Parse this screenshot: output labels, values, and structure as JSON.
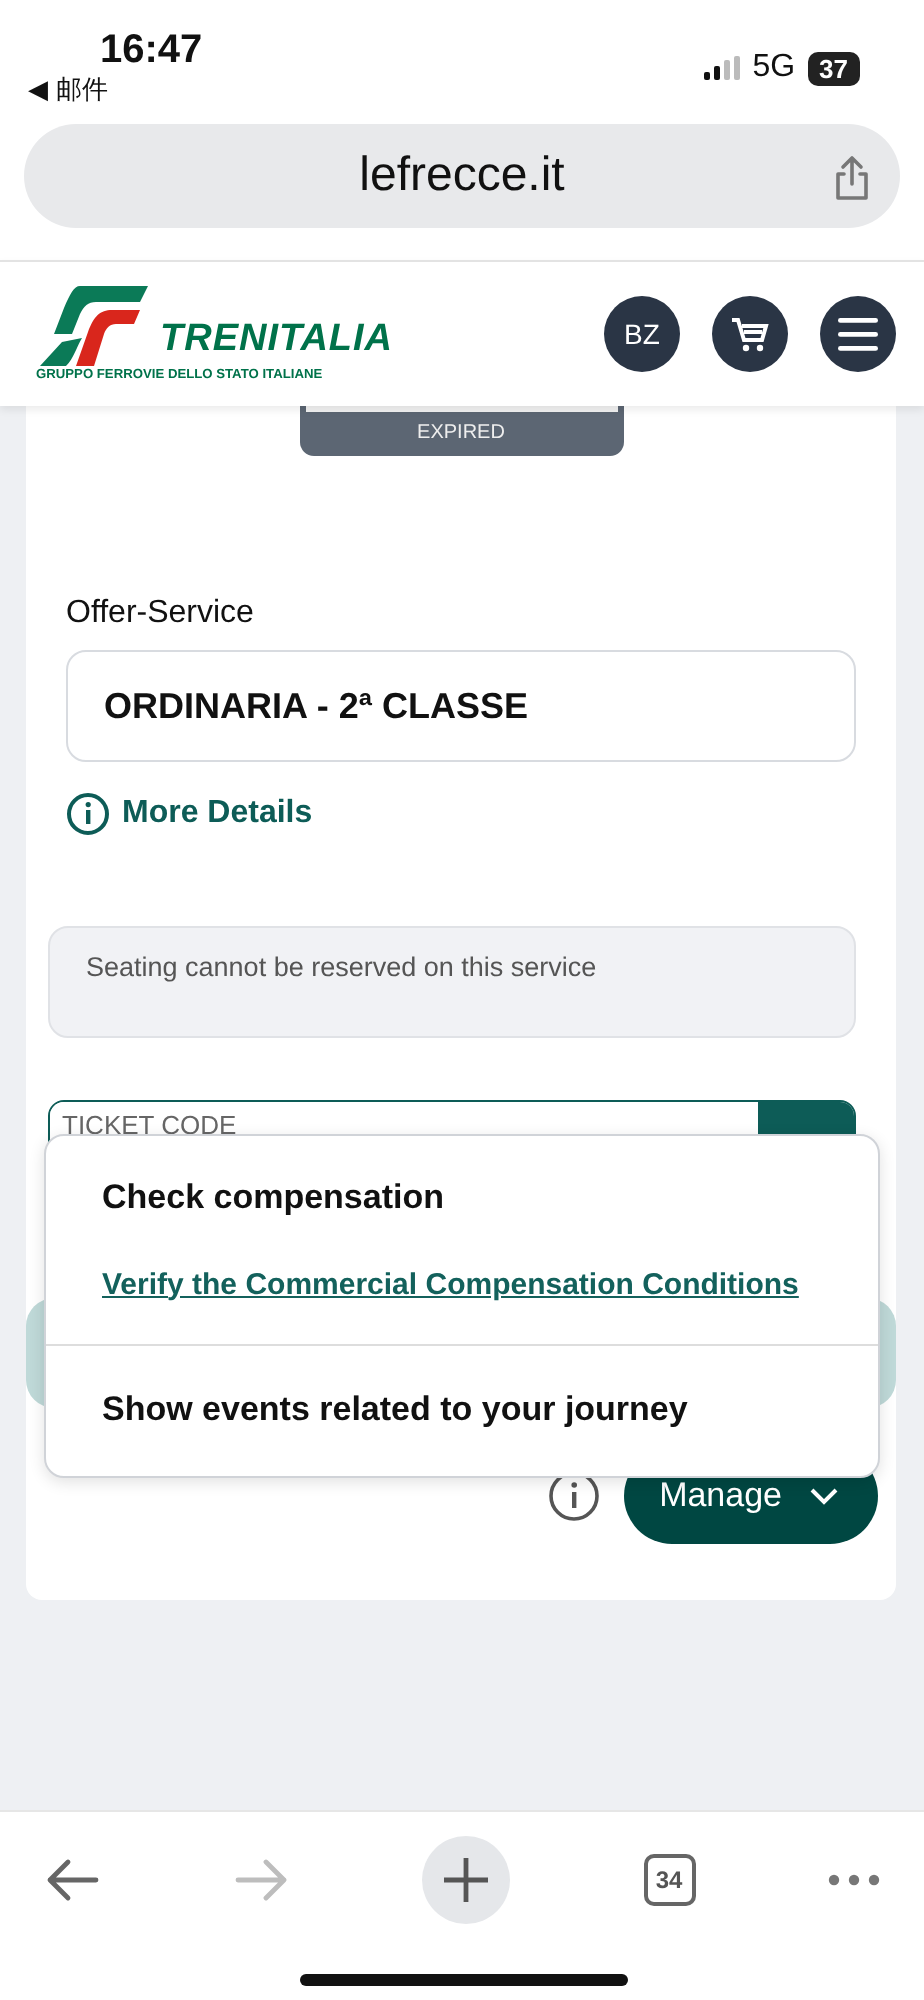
{
  "status_bar": {
    "time": "16:47",
    "back_app": "◀ 邮件",
    "network": "5G",
    "battery": "37"
  },
  "address_bar": {
    "url": "lefrecce.it"
  },
  "header": {
    "logo_name": "TRENITALIA",
    "logo_tagline": "GRUPPO FERROVIE DELLO STATO ITALIANE",
    "user_initials": "BZ"
  },
  "ticket": {
    "status": "EXPIRED",
    "offer_label": "Offer-Service",
    "offer_value": "ORDINARIA - 2ª CLASSE",
    "more_details": "More Details",
    "seating_note": "Seating cannot be reserved on this service",
    "ticket_code": {
      "placeholder": "TICKET CODE"
    }
  },
  "dropdown": {
    "expanded": true,
    "items": [
      {
        "kind": "heading",
        "text": "Check compensation"
      },
      {
        "kind": "link",
        "text": "Verify the Commercial Compensation Conditions"
      },
      {
        "kind": "action",
        "text": "Show events related to your journey"
      }
    ]
  },
  "manage_button": {
    "label": "Manage"
  },
  "toolbar": {
    "tab_count": "34",
    "forward_disabled": true
  }
}
